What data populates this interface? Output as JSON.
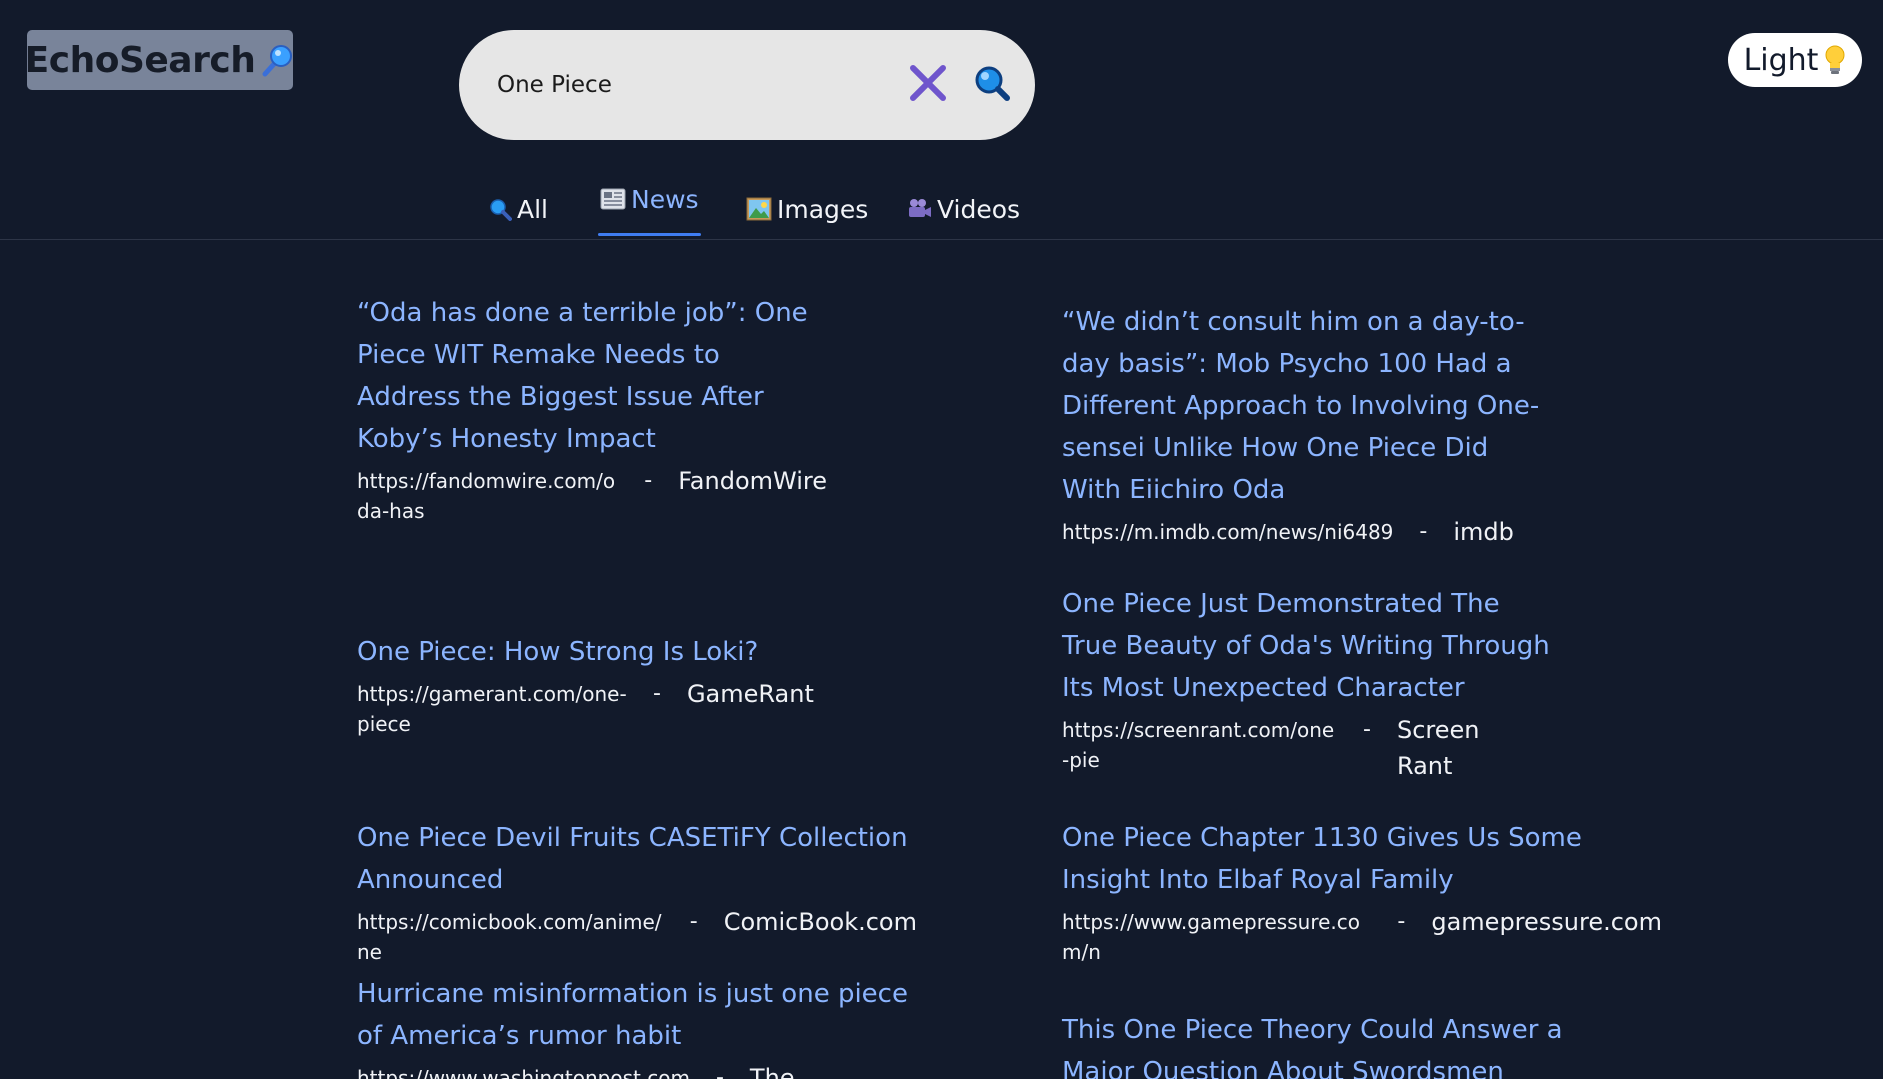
{
  "header": {
    "logo_text": "EchoSearch",
    "logo_icon": "magnifier-icon",
    "theme_toggle_label": "Light",
    "theme_toggle_icon": "lightbulb-icon"
  },
  "search": {
    "value": "One Piece",
    "placeholder": "",
    "clear_icon": "close-icon",
    "submit_icon": "search-icon"
  },
  "tabs": [
    {
      "label": "All",
      "icon": "magnifier-icon",
      "active": false
    },
    {
      "label": "News",
      "icon": "newspaper-icon",
      "active": true
    },
    {
      "label": "Images",
      "icon": "picture-icon",
      "active": false
    },
    {
      "label": "Videos",
      "icon": "camera-icon",
      "active": false
    }
  ],
  "results": [
    {
      "title": "“Oda has done a terrible job”: One Piece WIT Remake Needs to Address the Biggest Issue After Koby’s Honesty Impact",
      "url": "https://fandomwire.com/oda-has",
      "source": "FandomWire"
    },
    {
      "title": "“We didn’t consult him on a day-to-day basis”: Mob Psycho 100 Had a Different Approach to Involving One-sensei Unlike How One Piece Did With Eiichiro Oda",
      "url": "https://m.imdb.com/news/ni6489",
      "source": "imdb"
    },
    {
      "title": "One Piece: How Strong Is Loki?",
      "url": "https://gamerant.com/one-piece",
      "source": "GameRant"
    },
    {
      "title": "One Piece Just Demonstrated The True Beauty of Oda's Writing Through Its Most Unexpected Character",
      "url": "https://screenrant.com/one-pie",
      "source": "Screen Rant"
    },
    {
      "title": "One Piece Devil Fruits CASETiFY Collection Announced",
      "url": "https://comicbook.com/anime/ne",
      "source": "ComicBook.com"
    },
    {
      "title": "One Piece Chapter 1130 Gives Us Some Insight Into Elbaf Royal Family",
      "url": "https://www.gamepressure.com/n",
      "source": "gamepressure.com"
    },
    {
      "title": "Hurricane misinformation is just one piece of America’s rumor habit",
      "url": "https://www.washingtonpost.com",
      "source": "The"
    },
    {
      "title": "This One Piece Theory Could Answer a Major Question About Swordsmen",
      "url": "",
      "source": ""
    }
  ],
  "colors": {
    "background": "#121a2b",
    "link": "#8cb5ff",
    "active_tab_underline": "#3f7df2",
    "logo_bg": "#79849a",
    "search_bg": "#e6e6e6",
    "clear_icon": "#6f55cc"
  }
}
